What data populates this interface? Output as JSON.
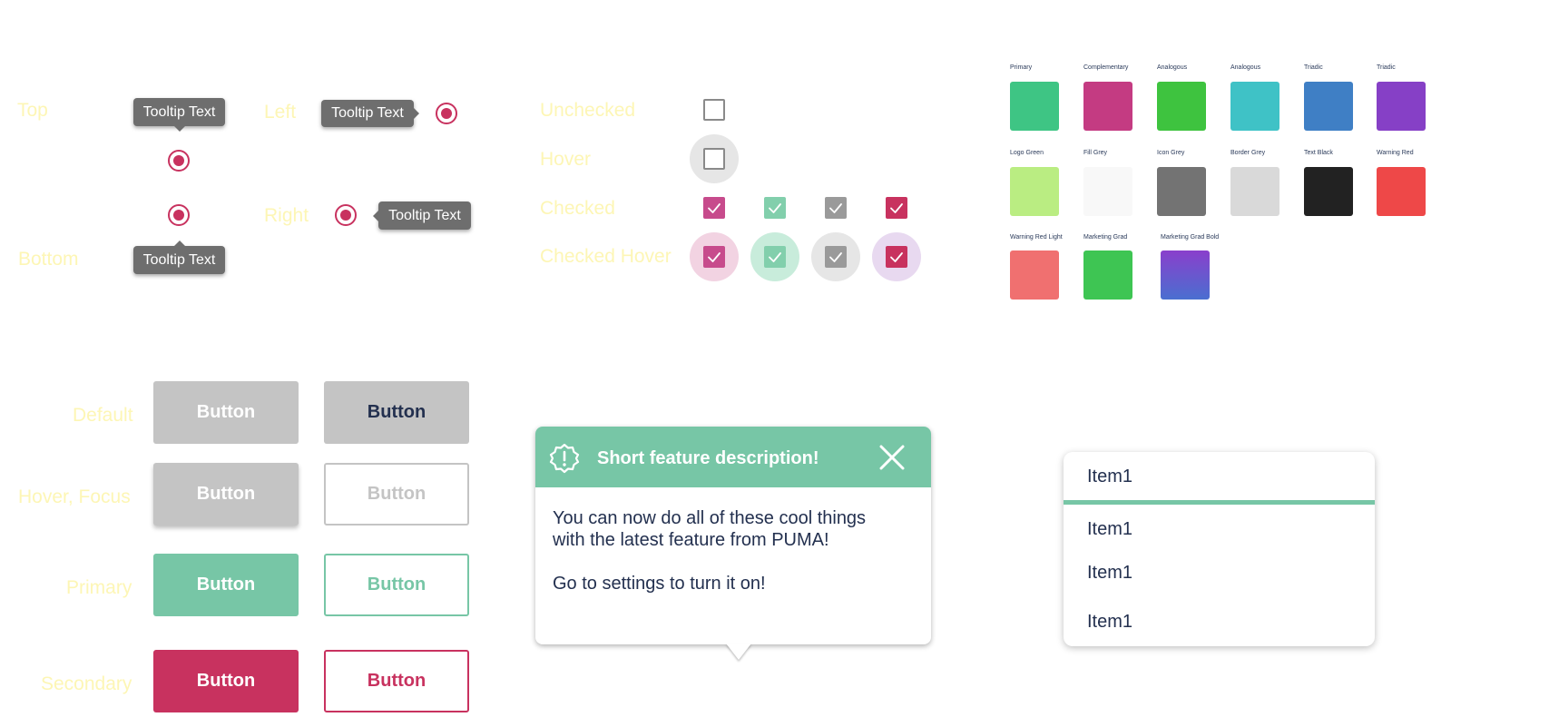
{
  "tooltips": {
    "labels": {
      "top": "Top",
      "bottom": "Bottom",
      "left": "Left",
      "right": "Right"
    },
    "tooltip_text": "Tooltip Text"
  },
  "checkboxes": {
    "labels": {
      "unchecked": "Unchecked",
      "hover": "Hover",
      "checked": "Checked",
      "checked_hover": "Checked Hover"
    },
    "colors": [
      "#c74b8c",
      "#82cfac",
      "#9a9a9a",
      "#c8325f"
    ],
    "hover_halos": [
      "#f2d3e2",
      "#c8ecdb",
      "#e6e6e6",
      "#e8d9f0"
    ]
  },
  "palette": {
    "rows": [
      [
        {
          "label": "Primary",
          "color": "#3ec584"
        },
        {
          "label": "Complementary",
          "color": "#c43b82"
        },
        {
          "label": "Analogous",
          "color": "#3ec33f"
        },
        {
          "label": "Analogous",
          "color": "#3fc2c6"
        },
        {
          "label": "Triadic",
          "color": "#3f7fc5"
        },
        {
          "label": "Triadic",
          "color": "#8640c6"
        }
      ],
      [
        {
          "label": "Logo Green",
          "color": "#baed82"
        },
        {
          "label": "Fill Grey",
          "color": "#f8f8f8"
        },
        {
          "label": "Icon Grey",
          "color": "#737373"
        },
        {
          "label": "Border Grey",
          "color": "#d9d9d9"
        },
        {
          "label": "Text Black",
          "color": "#222222"
        },
        {
          "label": "Warning Red",
          "color": "#ee4848"
        }
      ],
      [
        {
          "label": "Warning Red Light",
          "color": "#f07070"
        },
        {
          "label": "Marketing Grad",
          "color": "#3ec553"
        },
        {
          "label": "Marketing Grad Bold",
          "color": "gradient"
        }
      ]
    ]
  },
  "buttons": {
    "row_labels": {
      "default": "Default",
      "hover_focus": "Hover, Focus",
      "primary": "Primary",
      "secondary": "Secondary"
    },
    "label": "Button"
  },
  "feature_popup": {
    "title": "Short feature description!",
    "body_line1": "You can now do all of these cool things",
    "body_line2": "with the latest feature from PUMA!",
    "body_line3": "Go to settings to turn it on!"
  },
  "dropdown": {
    "items": [
      "Item1",
      "Item1",
      "Item1",
      "Item1"
    ]
  },
  "colors": {
    "primary_green": "#77c6a6",
    "secondary_red": "#c8325f",
    "navy_text": "#23304f",
    "label_yellow": "#fdf6b5"
  }
}
